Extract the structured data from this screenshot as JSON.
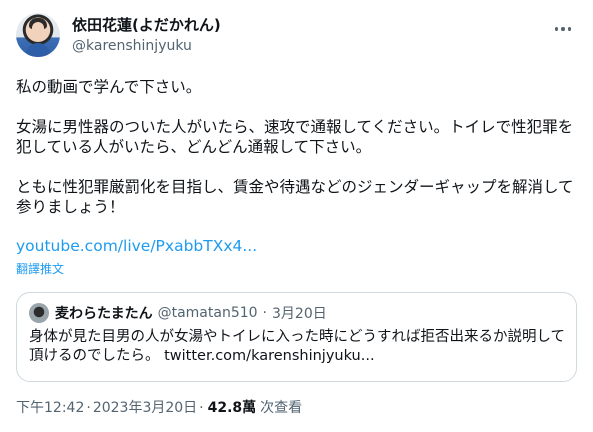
{
  "author": {
    "display_name": "依田花蓮(よだかれん)",
    "handle": "@karenshinjyuku"
  },
  "tweet": {
    "line1": "私の動画で学んで下さい。",
    "line2": "女湯に男性器のついた人がいたら、速攻で通報してください。トイレで性犯罪を犯している人がいたら、どんどん通報して下さい。",
    "line3": "ともに性犯罪厳罰化を目指し、賃金や待遇などのジェンダーギャップを解消して参りましょう！",
    "link": "youtube.com/live/PxabbTXx4...",
    "translate_label": "翻譯推文"
  },
  "quote": {
    "display_name": "麦わらたまたん",
    "handle": "@tamatan510",
    "separator": "·",
    "date": "3月20日",
    "text": "身体が見た目男の人が女湯やトイレに入った時にどうすれば拒否出来るか説明して頂けるのでしたら。",
    "link": "twitter.com/karenshinjyuku..."
  },
  "footer": {
    "time": "下午12:42",
    "separator": "·",
    "date": "2023年3月20日",
    "views_count": "42.8萬",
    "views_label": "次查看"
  },
  "icons": {
    "more": "more-horizontal-icon"
  },
  "colors": {
    "link": "#1d9bf0",
    "secondary_text": "#536471",
    "border": "#cfd9de"
  }
}
